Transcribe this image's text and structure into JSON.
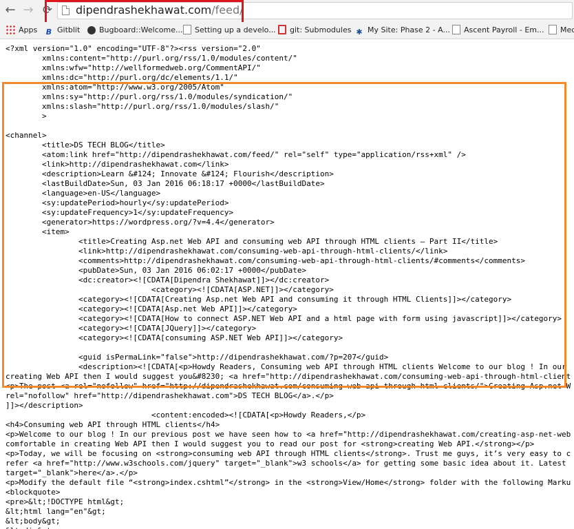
{
  "browser": {
    "url_domain": "dipendrashekhawat.com",
    "url_path": "/feed/",
    "back_glyph": "←",
    "forward_glyph": "→",
    "reload_glyph": "⟳"
  },
  "bookmarks": [
    {
      "label": "Apps",
      "icon": "apps-grid-icon"
    },
    {
      "label": "Gitblit",
      "icon": "gitblit-icon"
    },
    {
      "label": "Bugboard::Welcome...",
      "icon": "bugboard-icon"
    },
    {
      "label": "Setting up a develo...",
      "icon": "page-icon"
    },
    {
      "label": "git: Submodules",
      "icon": "git-icon"
    },
    {
      "label": "My Site: Phase 2 - A...",
      "icon": "mysite-icon"
    },
    {
      "label": "Ascent Payroll - Em...",
      "icon": "page-icon"
    },
    {
      "label": "Med",
      "icon": "page-icon"
    }
  ],
  "feed_lines": [
    "<?xml version=\"1.0\" encoding=\"UTF-8\"?><rss version=\"2.0\"",
    "\txmlns:content=\"http://purl.org/rss/1.0/modules/content/\"",
    "\txmlns:wfw=\"http://wellformedweb.org/CommentAPI/\"",
    "\txmlns:dc=\"http://purl.org/dc/elements/1.1/\"",
    "\txmlns:atom=\"http://www.w3.org/2005/Atom\"",
    "\txmlns:sy=\"http://purl.org/rss/1.0/modules/syndication/\"",
    "\txmlns:slash=\"http://purl.org/rss/1.0/modules/slash/\"",
    "\t>",
    "",
    "<channel>",
    "\t<title>DS TECH BLOG</title>",
    "\t<atom:link href=\"http://dipendrashekhawat.com/feed/\" rel=\"self\" type=\"application/rss+xml\" />",
    "\t<link>http://dipendrashekhawat.com</link>",
    "\t<description>Learn &#124; Innovate &#124; Flourish</description>",
    "\t<lastBuildDate>Sun, 03 Jan 2016 06:18:17 +0000</lastBuildDate>",
    "\t<language>en-US</language>",
    "\t<sy:updatePeriod>hourly</sy:updatePeriod>",
    "\t<sy:updateFrequency>1</sy:updateFrequency>",
    "\t<generator>https://wordpress.org/?v=4.4</generator>",
    "\t<item>",
    "\t\t<title>Creating Asp.net Web API and consuming web API through HTML clients – Part II</title>",
    "\t\t<link>http://dipendrashekhawat.com/consuming-web-api-through-html-clients/</link>",
    "\t\t<comments>http://dipendrashekhawat.com/consuming-web-api-through-html-clients/#comments</comments>",
    "\t\t<pubDate>Sun, 03 Jan 2016 06:02:17 +0000</pubDate>",
    "\t\t<dc:creator><![CDATA[Dipendra Shekhawat]]></dc:creator>",
    "\t\t\t\t<category><![CDATA[ASP.NET]]></category>",
    "\t\t<category><![CDATA[Creating Asp.net Web API and consuming it through HTML Clients]]></category>",
    "\t\t<category><![CDATA[Asp.net Web API]]></category>",
    "\t\t<category><![CDATA[How to connect ASP.NET Web API and a html page with form using javascript]]></category>",
    "\t\t<category><![CDATA[JQuery]]></category>",
    "\t\t<category><![CDATA[consuming ASP.NET Web API]]></category>",
    "",
    "\t\t<guid isPermaLink=\"false\">http://dipendrashekhawat.com/?p=207</guid>",
    "\t\t<description><![CDATA[<p>Howdy Readers, Consuming web API through HTML clients Welcome to our blog ! In our",
    "creating Web API then I would suggest you&#8230; <a href=\"http://dipendrashekhawat.com/consuming-web-api-through-html-client",
    "<p>The post <a rel=\"nofollow\" href=\"http://dipendrashekhawat.com/consuming-web-api-through-html-clients/\">Creating Asp.net W",
    "rel=\"nofollow\" href=\"http://dipendrashekhawat.com\">DS TECH BLOG</a>.</p>",
    "]]></description>",
    "\t\t\t\t<content:encoded><![CDATA[<p>Howdy Readers,</p>",
    "<h4>Consuming web API through HTML clients</h4>",
    "<p>Welcome to our blog ! In our previous post we have seen how to <a href=\"http://dipendrashekhawat.com/creating-asp-net-web",
    "comfortable in creating Web API then I would suggest you to read our post for <strong>creating Web API.</strong></p>",
    "<p>Today, we will be focusing on <strong>consuming web API through HTML clients</strong>. Trust me guys, it’s very easy to c",
    "refer <a href=\"http://www.w3schools.com/jquery\" target=\"_blank\">w3 schools</a> for getting some basic idea about it. Latest",
    "target=\"_blank\">here</a>.</p>",
    "<p>Modify the default file “<strong>index.cshtml”</strong> in the <strong>View/Home</strong> folder with the following Marku",
    "<blockquote>",
    "<pre>&lt;!DOCTYPE html&gt;",
    "&lt;html lang=\"en\"&gt;",
    "&lt;body&gt;",
    "&lt;div&gt;"
  ]
}
